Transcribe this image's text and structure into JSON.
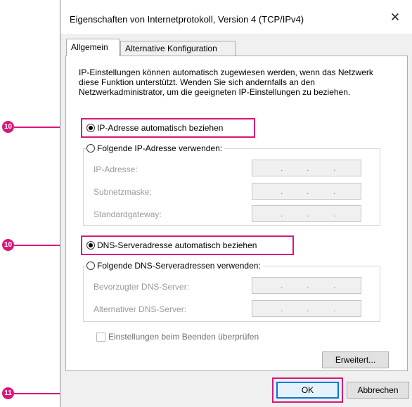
{
  "window": {
    "title": "Eigenschaften von Internetprotokoll, Version 4 (TCP/IPv4)",
    "close_glyph": "✕"
  },
  "tabs": [
    {
      "label": "Allgemein"
    },
    {
      "label": "Alternative Konfiguration"
    }
  ],
  "description": "IP-Einstellungen können automatisch zugewiesen werden, wenn das Netzwerk diese Funktion unterstützt. Wenden Sie sich andernfalls an den Netzwerkadministrator, um die geeigneten IP-Einstellungen zu beziehen.",
  "ip_section": {
    "auto_label": "IP-Adresse automatisch beziehen",
    "manual_label": "Folgende IP-Adresse verwenden:",
    "fields": [
      {
        "label": "IP-Adresse:"
      },
      {
        "label": "Subnetzmaske:"
      },
      {
        "label": "Standardgateway:"
      }
    ]
  },
  "dns_section": {
    "auto_label": "DNS-Serveradresse automatisch beziehen",
    "manual_label": "Folgende DNS-Serveradressen verwenden:",
    "fields": [
      {
        "label": "Bevorzugter DNS-Server:"
      },
      {
        "label": "Alternativer DNS-Server:"
      }
    ]
  },
  "validate_label": "Einstellungen beim Beenden überprüfen",
  "buttons": {
    "advanced": "Erweitert...",
    "ok": "OK",
    "cancel": "Abbrechen"
  },
  "ip_dot": ".",
  "callouts": [
    {
      "number": "10"
    },
    {
      "number": "10"
    },
    {
      "number": "11"
    }
  ],
  "colors": {
    "accent": "#d8177b",
    "focus": "#0078d7"
  }
}
